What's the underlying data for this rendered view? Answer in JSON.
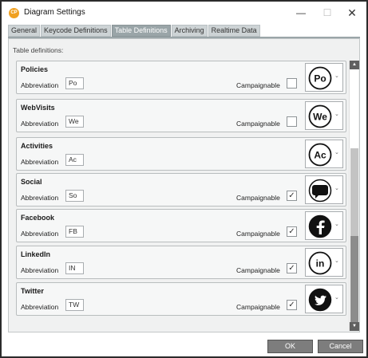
{
  "window": {
    "title": "Diagram Settings",
    "app_icon_text": "CP",
    "controls": {
      "minimize": "—",
      "maximize": "☐",
      "close": "✕"
    }
  },
  "tabs": [
    {
      "label": "General",
      "active": false
    },
    {
      "label": "Keycode Definitions",
      "active": false
    },
    {
      "label": "Table Definitions",
      "active": true
    },
    {
      "label": "Archiving",
      "active": false
    },
    {
      "label": "Realtime Data",
      "active": false
    }
  ],
  "panel": {
    "section_label": "Table definitions:",
    "abbreviation_label": "Abbreviation",
    "campaignable_label": "Campaignable",
    "rows": [
      {
        "name": "Policies",
        "abbreviation": "Po",
        "has_campaignable": true,
        "campaignable": false,
        "icon": "po-text-circle-icon",
        "icon_text": "Po"
      },
      {
        "name": "WebVisits",
        "abbreviation": "We",
        "has_campaignable": true,
        "campaignable": false,
        "icon": "we-text-circle-icon",
        "icon_text": "We"
      },
      {
        "name": "Activities",
        "abbreviation": "Ac",
        "has_campaignable": false,
        "campaignable": false,
        "icon": "ac-text-circle-icon",
        "icon_text": "Ac"
      },
      {
        "name": "Social",
        "abbreviation": "So",
        "has_campaignable": true,
        "campaignable": true,
        "icon": "speech-bubble-icon",
        "icon_text": ""
      },
      {
        "name": "Facebook",
        "abbreviation": "FB",
        "has_campaignable": true,
        "campaignable": true,
        "icon": "facebook-icon",
        "icon_text": ""
      },
      {
        "name": "LinkedIn",
        "abbreviation": "IN",
        "has_campaignable": true,
        "campaignable": true,
        "icon": "linkedin-icon",
        "icon_text": "in"
      },
      {
        "name": "Twitter",
        "abbreviation": "TW",
        "has_campaignable": true,
        "campaignable": true,
        "icon": "twitter-icon",
        "icon_text": ""
      }
    ]
  },
  "buttons": {
    "ok": "OK",
    "cancel": "Cancel"
  },
  "colors": {
    "active_tab": "#9aa5a8",
    "button": "#7d7d7d",
    "app_icon": "#f0a020"
  }
}
